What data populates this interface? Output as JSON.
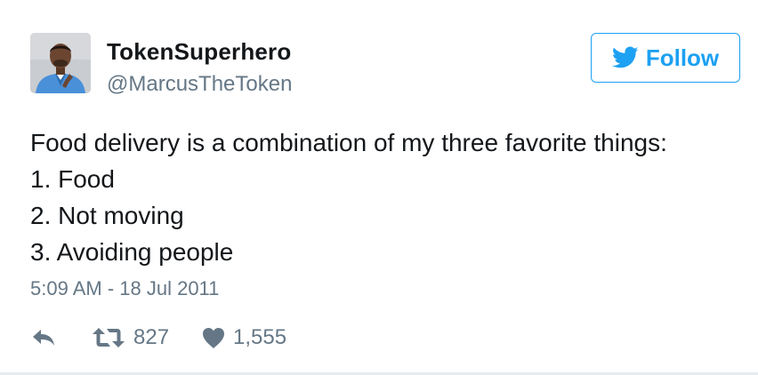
{
  "author": {
    "display_name": "TokenSuperhero",
    "handle": "@MarcusTheToken"
  },
  "follow_button": {
    "label": "Follow",
    "icon": "twitter-bird-icon"
  },
  "tweet": {
    "lines": [
      "Food delivery is a combination of my three favorite things:",
      "1. Food",
      "2. Not moving",
      "3. Avoiding people"
    ],
    "timestamp": "5:09 AM - 18 Jul 2011"
  },
  "actions": {
    "reply_icon": "reply-icon",
    "retweet_icon": "retweet-icon",
    "retweet_count": "827",
    "like_icon": "heart-icon",
    "like_count": "1,555"
  },
  "colors": {
    "accent": "#1da1f2",
    "text": "#14171a",
    "muted": "#657786"
  }
}
